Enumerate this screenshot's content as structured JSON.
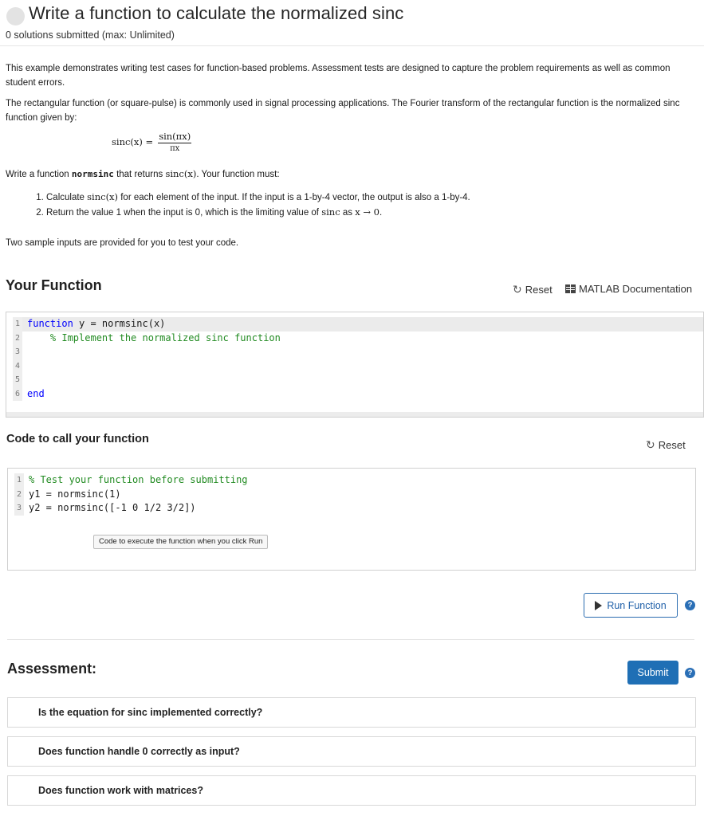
{
  "header": {
    "title": "Write a function to calculate the normalized sinc",
    "submissions": "0 solutions submitted (max: Unlimited)"
  },
  "description": {
    "p1": "This example demonstrates writing test cases for function-based problems. Assessment tests are designed to capture the problem requirements as well as common student errors.",
    "p2": "The rectangular function (or square-pulse) is commonly used in signal processing applications. The Fourier transform of the rectangular function is the normalized sinc function given by:",
    "formula_lhs": "sinc(x) =",
    "formula_num": "sin(πx)",
    "formula_den": "πx",
    "p3_pre": "Write a function ",
    "p3_fn": "normsinc",
    "p3_mid": " that returns ",
    "p3_math": "sinc(x)",
    "p3_post": ".  Your function must:",
    "li1_pre": "Calculate ",
    "li1_math": "sinc(x)",
    "li1_post": " for each element of the input. If the input is a 1-by-4  vector, the output is also a 1-by-4.",
    "li2_pre": "Return the value 1 when the input is 0, which is the limiting value of ",
    "li2_math": "sinc",
    "li2_mid": " as ",
    "li2_math2": "x → 0",
    "li2_post": ".",
    "p4": "Two sample inputs are provided for you to test your code."
  },
  "your_function": {
    "heading": "Your Function",
    "reset_label": "Reset",
    "doc_label": "MATLAB Documentation",
    "lines": [
      {
        "n": "1",
        "kw": "function",
        "text": " y = normsinc(x)"
      },
      {
        "n": "2",
        "cm": "    % Implement the normalized sinc function"
      },
      {
        "n": "3",
        "text": ""
      },
      {
        "n": "4",
        "text": ""
      },
      {
        "n": "5",
        "text": ""
      },
      {
        "n": "6",
        "kw": "end",
        "text": ""
      }
    ]
  },
  "call_function": {
    "heading": "Code to call your function",
    "reset_label": "Reset",
    "lines": [
      {
        "n": "1",
        "cm": "% Test your function before submitting"
      },
      {
        "n": "2",
        "text": "y1 = normsinc(1)"
      },
      {
        "n": "3",
        "text": "y2 = normsinc([-1 0 1/2 3/2])"
      }
    ],
    "hint": "Code to execute the function when you click Run"
  },
  "run_button": "Run Function",
  "assessment": {
    "heading": "Assessment:",
    "submit_label": "Submit",
    "tests": [
      "Is the equation for sinc implemented correctly?",
      "Does function handle 0 correctly as input?",
      "Does function work with matrices?"
    ]
  },
  "colors": {
    "accent": "#1f6fb5",
    "keyword": "#0000ff",
    "comment": "#228b22"
  },
  "icons": [
    "status-dot",
    "reset-icon",
    "documentation-icon",
    "play-icon",
    "help-icon"
  ]
}
